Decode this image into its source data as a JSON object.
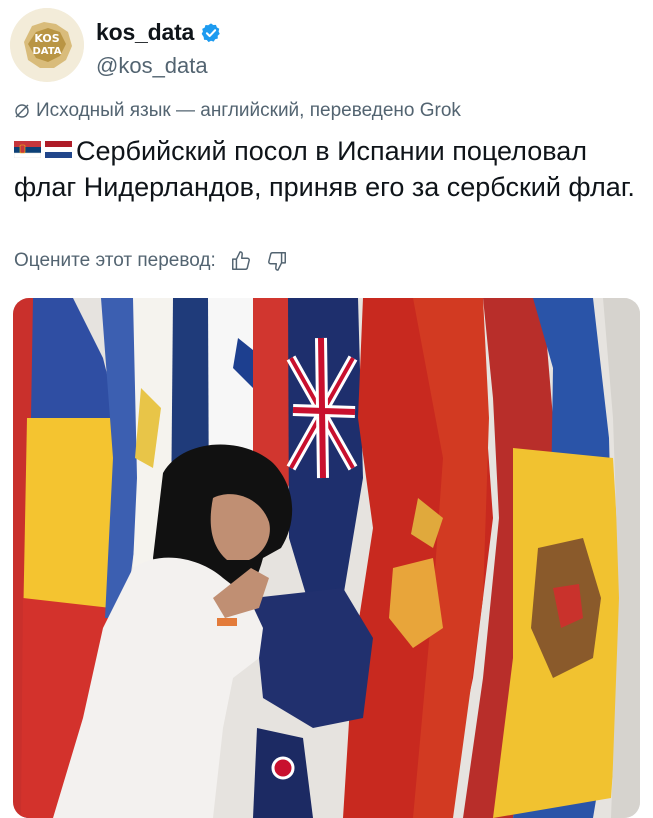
{
  "account": {
    "display_name": "kos_data",
    "handle": "@kos_data",
    "avatar_text": "KOS DATA",
    "verified": true
  },
  "tweet": {
    "source_language_note": "Исходный язык — английский, переведено Grok",
    "text": "Сербийский посол в Испании поцеловал флаг Нидерландов, приняв его за сербский флаг.",
    "flags_emoji": [
      "serbia-flag",
      "netherlands-flag"
    ],
    "rate_prompt": "Оцените этот перевод:"
  },
  "icons": {
    "translate": "slashed-globe-icon",
    "like": "thumbs-up-icon",
    "dislike": "thumbs-down-icon",
    "verified": "verified-badge-icon"
  },
  "colors": {
    "verified_blue": "#1d9bf0",
    "muted_text": "#536471",
    "text": "#0f1419"
  }
}
